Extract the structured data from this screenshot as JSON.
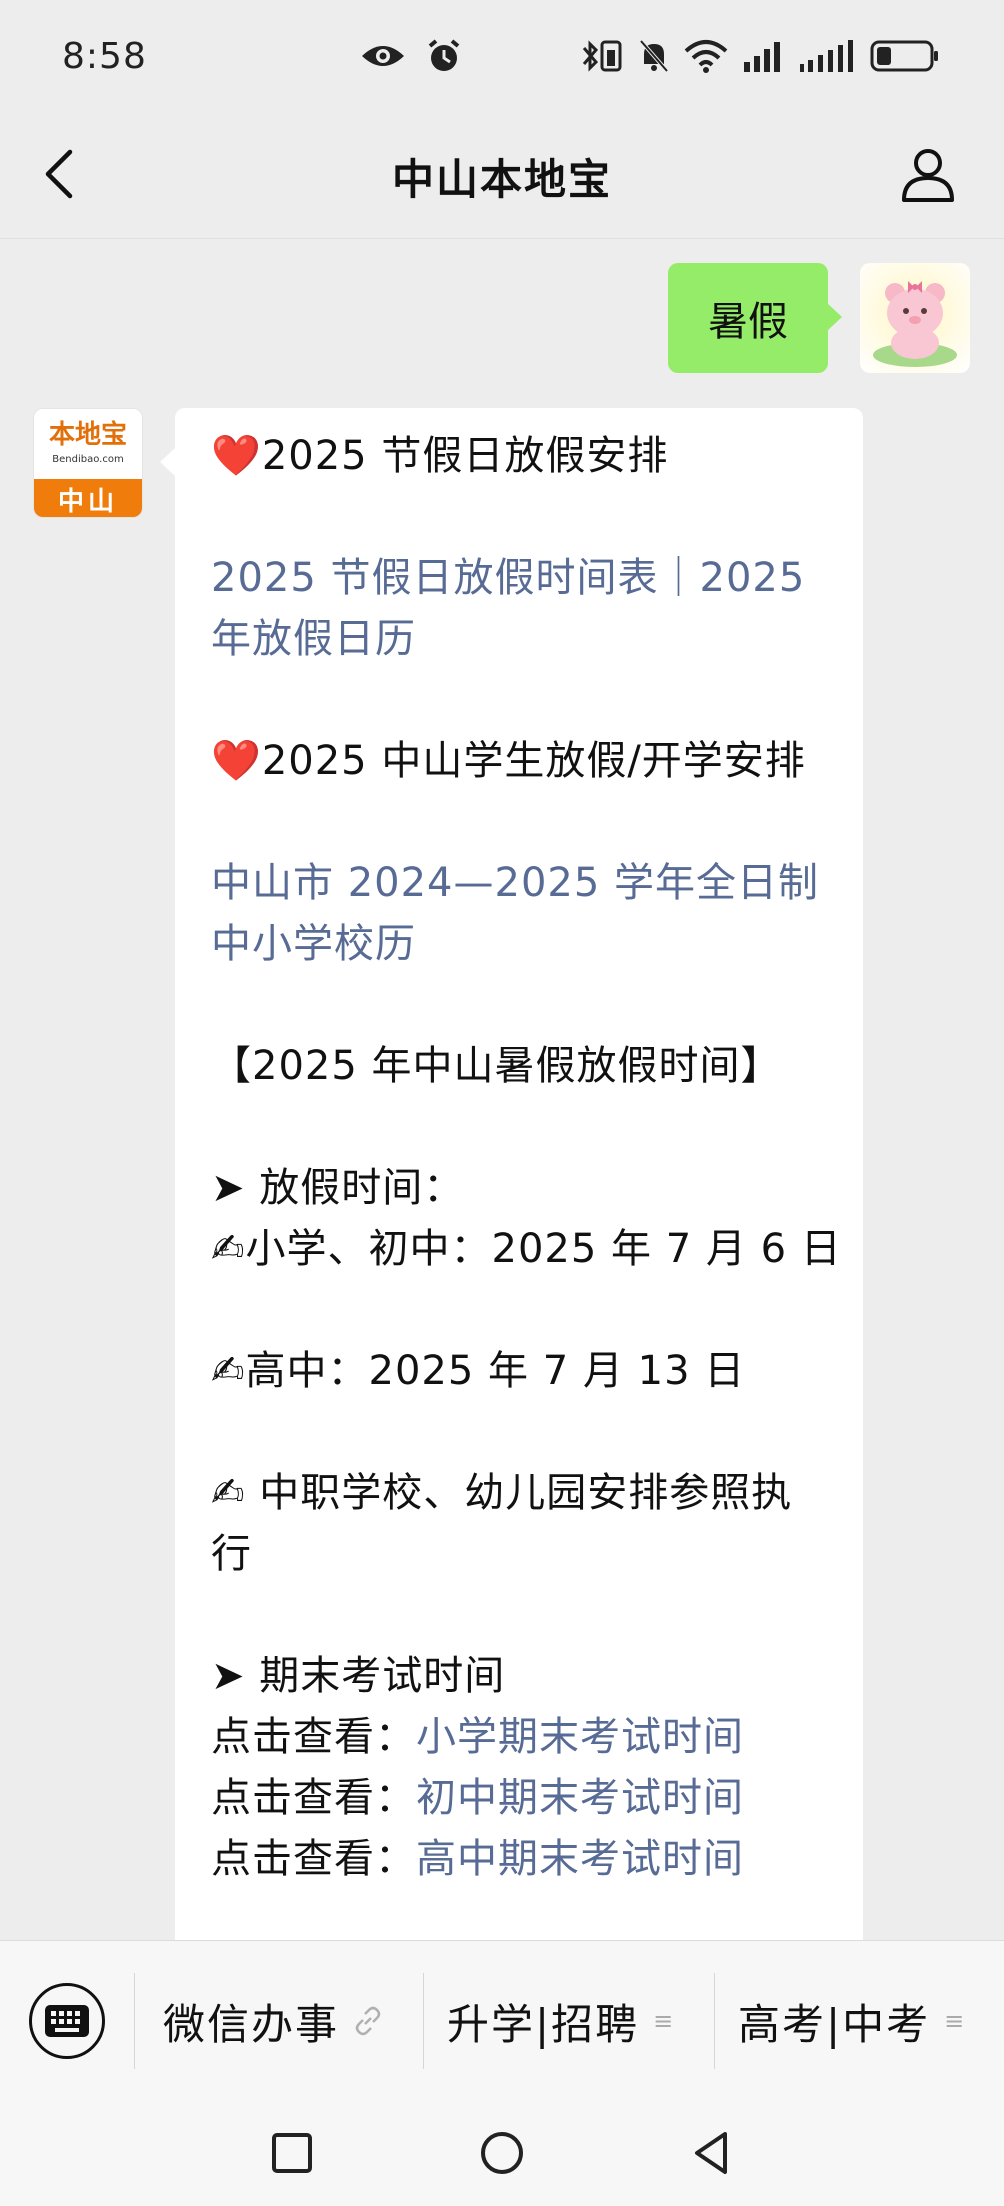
{
  "status_bar": {
    "time": "8:58"
  },
  "header": {
    "title": "中山本地宝"
  },
  "messages": {
    "user_text": "暑假",
    "bot_logo_cn": "本地宝",
    "bot_logo_en": "Bendibao.com",
    "bot_logo_city": "中山",
    "bot_lines": {
      "l1_heart": "❤️",
      "l1_text": "2025 节假日放假安排",
      "l2_link": "2025 节假日放假时间表｜2025 年放假日历",
      "l3_heart": "❤️",
      "l3_text": "2025 中山学生放假/开学安排",
      "l4_link": "中山市 2024—2025 学年全日制中小学校历",
      "l5_text": "【2025 年中山暑假放假时间】",
      "l6_text": "➤ 放假时间：",
      "l7_text": "✍小学、初中：2025 年 7 月 6 日",
      "l8_text": "✍高中：2025 年 7 月 13 日",
      "l9_text": "✍ 中职学校、幼儿园安排参照执行",
      "l10_text": "➤ 期末考试时间",
      "l11_prefix": "点击查看：",
      "l11_link": "小学期末考试时间",
      "l12_prefix": "点击查看：",
      "l12_link": "初中期末考试时间",
      "l13_prefix": "点击查看：",
      "l13_link": "高中期末考试时间"
    }
  },
  "menu_bar": {
    "items": [
      {
        "label": "微信办事",
        "suffix_icon": "link-icon"
      },
      {
        "label": "升学|招聘",
        "suffix_icon": "menu-list-icon"
      },
      {
        "label": "高考|中考",
        "suffix_icon": "menu-list-icon"
      }
    ],
    "menu_suffix": "≡"
  },
  "colors": {
    "chat_background": "#ededed",
    "user_bubble": "#95ec69",
    "link": "#576b95",
    "brand_orange": "#f07c0c"
  }
}
